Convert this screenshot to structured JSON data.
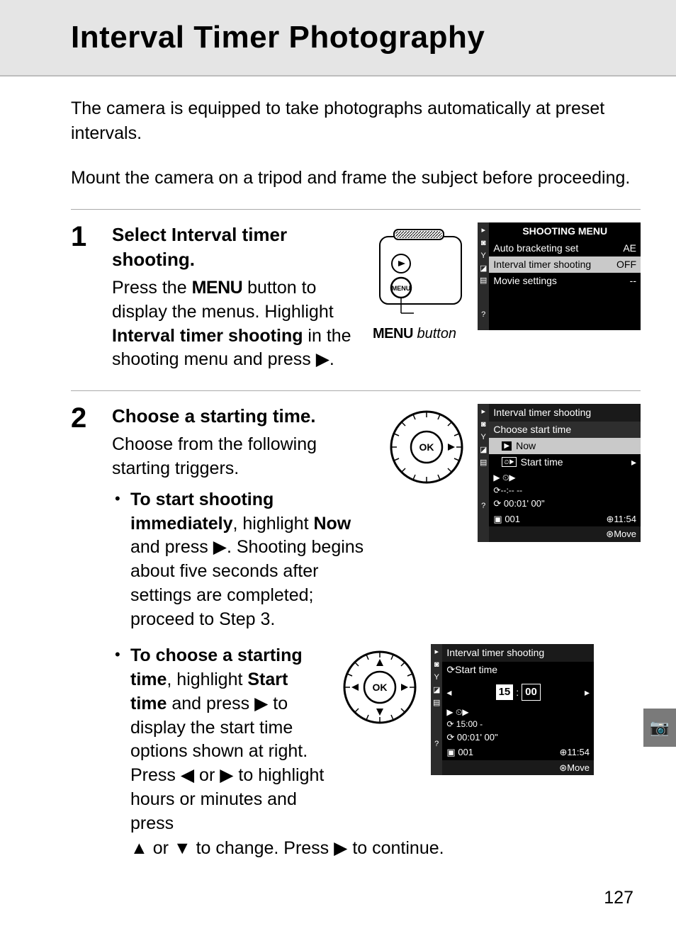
{
  "title": "Interval Timer Photography",
  "intro": [
    "The camera is equipped to take photographs automatically at preset intervals.",
    "Mount the camera on a tripod and frame the subject before proceeding."
  ],
  "page_number": "127",
  "menu_label": "MENU",
  "menu_button_caption": "MENU button",
  "step1": {
    "num": "1",
    "heading_prefix": "Select ",
    "heading_bold": "Interval timer shooting",
    "heading_suffix": ".",
    "body_1": "Press the ",
    "body_2": " button to display the menus. Highlight ",
    "body_bold": "Interval timer shooting",
    "body_3": " in the shooting menu and press ",
    "body_4": "."
  },
  "lcd1": {
    "header": "SHOOTING MENU",
    "rows": [
      {
        "label": "Auto bracketing set",
        "value": "AE"
      },
      {
        "label": "Interval timer shooting",
        "value": "OFF"
      },
      {
        "label": "Movie settings",
        "value": "--"
      }
    ]
  },
  "step2": {
    "num": "2",
    "heading": "Choose a starting time.",
    "body": "Choose from the following starting triggers.",
    "bullet1": {
      "lead_bold": "To start shooting immediately",
      "t1": ", highlight ",
      "bold2": "Now",
      "t2": " and press ",
      "t3": ". Shooting begins about five seconds after settings are completed; proceed to Step 3."
    },
    "bullet2": {
      "lead_bold": "To choose a starting time",
      "t1": ", highlight ",
      "bold2": "Start time",
      "t2": " and press ",
      "t3": " to display the start time options shown at right.  Press ",
      "t4": " or ",
      "t5": " to highlight hours or minutes and press ",
      "t6": " or ",
      "t7": " to change.  Press ",
      "t8": " to continue."
    }
  },
  "lcd2": {
    "title": "Interval timer shooting",
    "subheader": "Choose start time",
    "opt_now": "Now",
    "opt_start": "Start time",
    "interval": "00:01' 00\"",
    "shots": "001",
    "clock": "11:54",
    "move": "Move"
  },
  "lcd3": {
    "title": "Interval timer shooting",
    "subheader": "Start time",
    "hours": "15",
    "minutes": "00",
    "start_val": "15:00",
    "interval": "00:01' 00\"",
    "shots": "001",
    "clock": "11:54",
    "move": "Move"
  },
  "icons": {
    "right": "▶",
    "left": "◀",
    "up": "▲",
    "down": "▼",
    "ok": "OK",
    "clock": "⊕",
    "play": "▶",
    "camera": "📷"
  }
}
